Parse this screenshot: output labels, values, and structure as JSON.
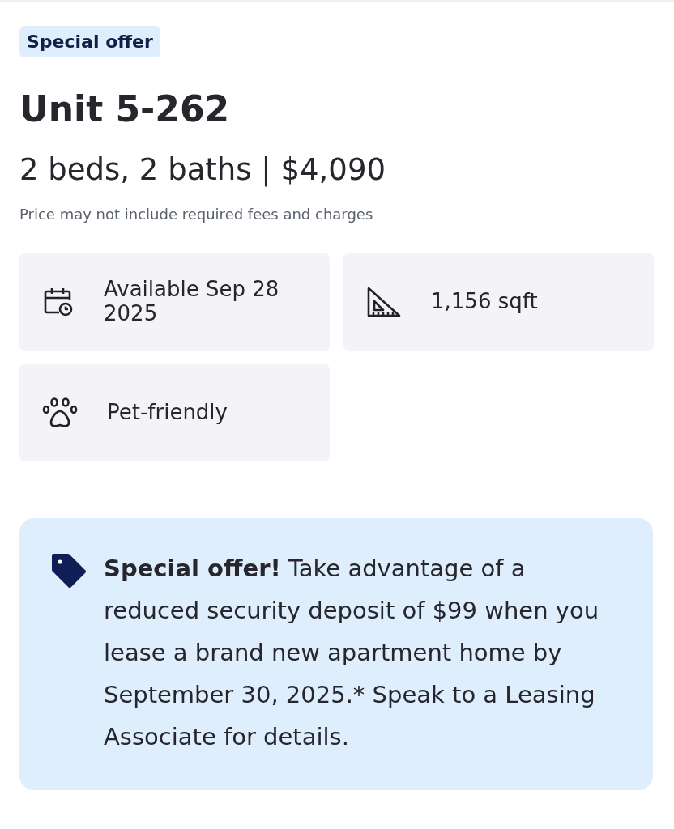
{
  "badge": "Special offer",
  "title": "Unit 5-262",
  "summary": "2 beds, 2 baths | $4,090",
  "note": "Price may not include required fees and charges",
  "features": [
    {
      "kind": "calendar",
      "text": "Available Sep 28 2025"
    },
    {
      "kind": "ruler",
      "text": "1,156 sqft"
    },
    {
      "kind": "paw",
      "text": "Pet-friendly"
    }
  ],
  "offer": {
    "text": "**Special offer!** Take advantage of a reduced security deposit of $99 when you lease a brand new apartment home by September 30, 2025.* Speak to a Leasing Associate for details."
  }
}
